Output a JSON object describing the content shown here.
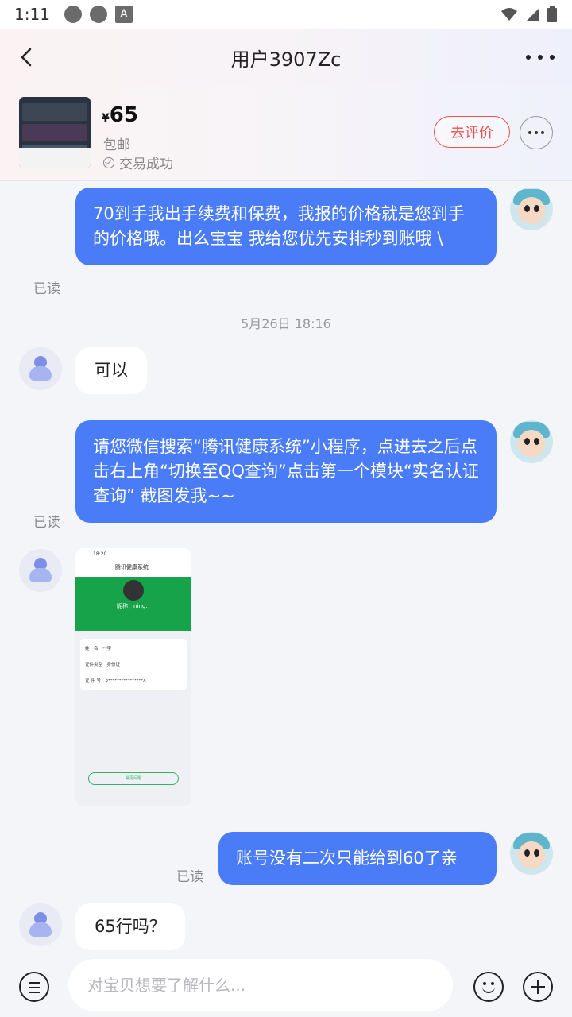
{
  "status_bar": {
    "time": "1:11"
  },
  "header": {
    "title": "用户3907Zc"
  },
  "product": {
    "currency": "¥",
    "price": "65",
    "shipping": "包邮",
    "status": "交易成功",
    "review_label": "去评价"
  },
  "messages": [
    {
      "side": "out",
      "text": "70到手我出手续费和保费，我报的价格就是您到手的价格哦。出么宝宝 我给您优先安排秒到账哦 \\",
      "read": "已读"
    },
    {
      "timestamp": "5月26日 18:16"
    },
    {
      "side": "in",
      "text": "可以"
    },
    {
      "side": "out",
      "text": "请您微信搜索“腾讯健康系统”小程序，点进去之后点击右上角“切换至QQ查询”点击第一个模块“实名认证查询” 截图发我~~",
      "read": "已读"
    },
    {
      "side": "in",
      "type": "image",
      "image": {
        "time": "18:20",
        "title": "腾讯健康系统",
        "name": "昵称：ning.",
        "rows": [
          {
            "label": "姓　名",
            "value": "**宇"
          },
          {
            "label": "证件类型",
            "value": "身份证"
          },
          {
            "label": "证 件 号",
            "value": "3****************X"
          }
        ],
        "button": "常见问题"
      }
    },
    {
      "side": "out",
      "text": "账号没有二次只能给到60了亲",
      "read": "已读"
    },
    {
      "side": "in",
      "text": "65行吗？"
    }
  ],
  "input": {
    "placeholder": "对宝贝想要了解什么..."
  },
  "icons": [
    "back-arrow-icon",
    "more-dots-icon",
    "check-circle-icon",
    "menu-icon",
    "emoji-icon",
    "plus-icon"
  ],
  "colors": {
    "accent": "#4b7cf8",
    "review": "#e8554e",
    "status_green": "#16a34a"
  }
}
